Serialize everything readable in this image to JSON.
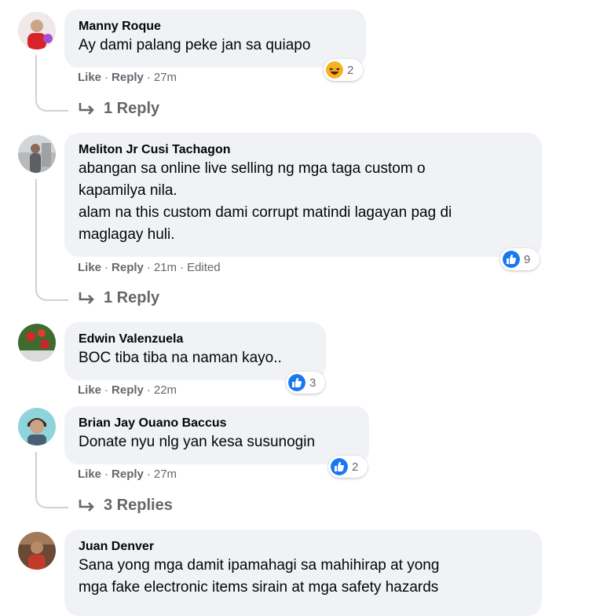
{
  "comments": [
    {
      "name": "Manny Roque",
      "text": "Ay dami palang peke jan sa quiapo",
      "like": "Like",
      "reply": "Reply",
      "time": "27m",
      "edited": "",
      "reaction_icon": "haha-icon",
      "reaction_count": "2",
      "replies_label": "1 Reply"
    },
    {
      "name": "Meliton Jr Cusi Tachagon",
      "text": "abangan sa online live selling ng mga taga custom o\nkapamilya nila.\nalam na this custom dami corrupt matindi lagayan pag di\nmaglagay huli.",
      "like": "Like",
      "reply": "Reply",
      "time": "21m",
      "edited": "Edited",
      "reaction_icon": "like-icon",
      "reaction_count": "9",
      "replies_label": "1 Reply"
    },
    {
      "name": "Edwin Valenzuela",
      "text": "BOC tiba tiba na naman kayo..",
      "like": "Like",
      "reply": "Reply",
      "time": "22m",
      "edited": "",
      "reaction_icon": "like-icon",
      "reaction_count": "3",
      "replies_label": ""
    },
    {
      "name": "Brian Jay Ouano Baccus",
      "text": "Donate nyu nlg yan kesa susunogin",
      "like": "Like",
      "reply": "Reply",
      "time": "27m",
      "edited": "",
      "reaction_icon": "like-icon",
      "reaction_count": "2",
      "replies_label": "3 Replies"
    },
    {
      "name": "Juan Denver",
      "text": "Sana yong mga damit ipamahagi sa mahihirap at yong\nmga fake electronic items sirain at mga safety hazards",
      "like": "",
      "reply": "",
      "time": "",
      "edited": "",
      "reaction_icon": "",
      "reaction_count": "",
      "replies_label": ""
    }
  ],
  "colors": {
    "bubble": "#f0f2f5",
    "meta": "#65676b",
    "like_blue": "#1877f2",
    "haha_yellow": "#f7b125"
  }
}
